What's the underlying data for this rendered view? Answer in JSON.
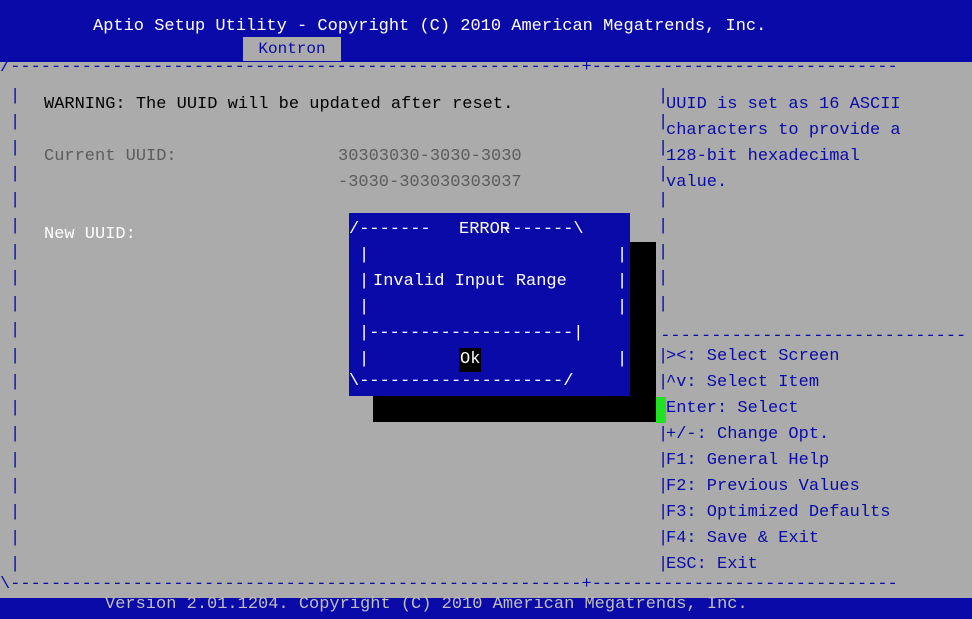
{
  "header": {
    "title": "Aptio Setup Utility - Copyright (C) 2010 American Megatrends, Inc.",
    "tab": "Kontron"
  },
  "main": {
    "warning": "WARNING: The UUID will be updated after reset.",
    "current_uuid_label": "Current UUID:",
    "current_uuid_line1": "30303030-3030-3030",
    "current_uuid_line2": "-3030-303030303037",
    "new_uuid_label": "New UUID:"
  },
  "help": {
    "lines": [
      "UUID is set as 16 ASCII",
      "characters to provide a",
      "128-bit hexadecimal",
      "value."
    ]
  },
  "keys": {
    "lines": [
      "><: Select Screen",
      "^v: Select Item",
      "Enter: Select",
      "+/-: Change Opt.",
      "F1: General Help",
      "F2: Previous Values",
      "F3: Optimized Defaults",
      "F4: Save & Exit",
      "ESC: Exit"
    ]
  },
  "dialog": {
    "title": "ERROR",
    "message": "Invalid Input Range",
    "ok_label": "Ok"
  },
  "footer": {
    "text": "Version 2.01.1204. Copyright (C) 2010 American Megatrends, Inc."
  },
  "colors": {
    "bios_blue": "#0a0aa8",
    "background_grey": "#ababab",
    "cursor_green": "#22e022"
  }
}
